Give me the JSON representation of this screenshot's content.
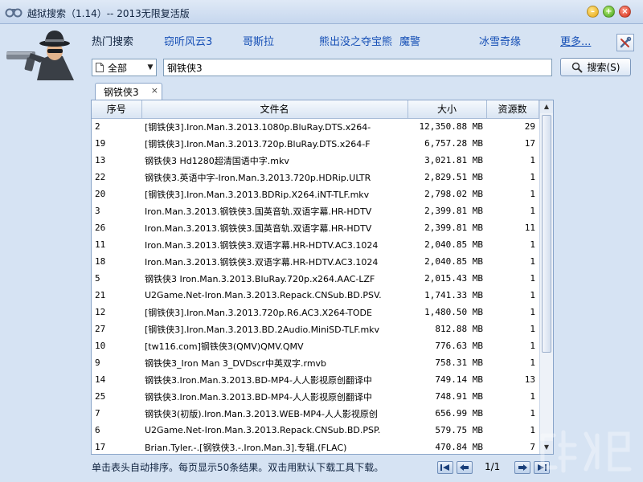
{
  "window": {
    "title": "越狱搜索（1.14）-- 2013无限复活版",
    "app_icon": "handcuffs-icon",
    "controls": [
      "minimize",
      "maximize",
      "close"
    ]
  },
  "hot_search": {
    "label": "热门搜索",
    "links": [
      "窃听风云3",
      "哥斯拉",
      "熊出没之夺宝熊",
      "魔警",
      "冰雪奇缘"
    ],
    "more_label": "更多..."
  },
  "search": {
    "scope_value": "全部",
    "query": "钢铁侠3",
    "button_label": "搜索(S)"
  },
  "tabs": [
    {
      "label": "钢铁侠3",
      "close_glyph": "×"
    }
  ],
  "table": {
    "columns": [
      "序号",
      "文件名",
      "大小",
      "资源数"
    ],
    "rows": [
      {
        "no": "2",
        "name": "[钢铁侠3].Iron.Man.3.2013.1080p.BluRay.DTS.x264-",
        "size": "12,350.88 MB",
        "sources": "29"
      },
      {
        "no": "19",
        "name": "[钢铁侠3].Iron.Man.3.2013.720p.BluRay.DTS.x264-F",
        "size": "6,757.28 MB",
        "sources": "17"
      },
      {
        "no": "13",
        "name": "钢铁侠3 Hd1280超清国语中字.mkv",
        "size": "3,021.81 MB",
        "sources": "1"
      },
      {
        "no": "22",
        "name": "钢铁侠3.英语中字-Iron.Man.3.2013.720p.HDRip.ULTR",
        "size": "2,829.51 MB",
        "sources": "1"
      },
      {
        "no": "20",
        "name": "[钢铁侠3].Iron.Man.3.2013.BDRip.X264.iNT-TLF.mkv",
        "size": "2,798.02 MB",
        "sources": "1"
      },
      {
        "no": "3",
        "name": "Iron.Man.3.2013.钢铁侠3.国英音轨.双语字幕.HR-HDTV",
        "size": "2,399.81 MB",
        "sources": "1"
      },
      {
        "no": "26",
        "name": "Iron.Man.3.2013.钢铁侠3.国英音轨.双语字幕.HR-HDTV",
        "size": "2,399.81 MB",
        "sources": "11"
      },
      {
        "no": "11",
        "name": "Iron.Man.3.2013.钢铁侠3.双语字幕.HR-HDTV.AC3.1024",
        "size": "2,040.85 MB",
        "sources": "1"
      },
      {
        "no": "18",
        "name": "Iron.Man.3.2013.钢铁侠3.双语字幕.HR-HDTV.AC3.1024",
        "size": "2,040.85 MB",
        "sources": "1"
      },
      {
        "no": "5",
        "name": "钢铁侠3 Iron.Man.3.2013.BluRay.720p.x264.AAC-LZF",
        "size": "2,015.43 MB",
        "sources": "1"
      },
      {
        "no": "21",
        "name": "U2Game.Net-Iron.Man.3.2013.Repack.CNSub.BD.PSV.",
        "size": "1,741.33 MB",
        "sources": "1"
      },
      {
        "no": "12",
        "name": "[钢铁侠3].Iron.Man.3.2013.720p.R6.AC3.X264-TODE",
        "size": "1,480.50 MB",
        "sources": "1"
      },
      {
        "no": "27",
        "name": "[钢铁侠3].Iron.Man.3.2013.BD.2Audio.MiniSD-TLF.mkv",
        "size": "812.88 MB",
        "sources": "1"
      },
      {
        "no": "10",
        "name": "[tw116.com]钢铁侠3(QMV)QMV.QMV",
        "size": "776.63 MB",
        "sources": "1"
      },
      {
        "no": "9",
        "name": "钢铁侠3_Iron Man 3_DVDscr中英双字.rmvb",
        "size": "758.31 MB",
        "sources": "1"
      },
      {
        "no": "14",
        "name": "钢铁侠3.Iron.Man.3.2013.BD-MP4-人人影视原创翻译中",
        "size": "749.14 MB",
        "sources": "13"
      },
      {
        "no": "25",
        "name": "钢铁侠3.Iron.Man.3.2013.BD-MP4-人人影视原创翻译中",
        "size": "748.91 MB",
        "sources": "1"
      },
      {
        "no": "7",
        "name": "钢铁侠3(初版).Iron.Man.3.2013.WEB-MP4-人人影视原创",
        "size": "656.99 MB",
        "sources": "1"
      },
      {
        "no": "6",
        "name": "U2Game.Net-Iron.Man.3.2013.Repack.CNSub.BD.PSP.",
        "size": "579.75 MB",
        "sources": "1"
      },
      {
        "no": "17",
        "name": "Brian.Tyler.-.[钢铁侠3.-.Iron.Man.3].专辑.(FLAC)",
        "size": "470.84 MB",
        "sources": "7"
      }
    ]
  },
  "status": {
    "hint": "单击表头自动排序。每页显示50条结果。双击用默认下载工具下载。",
    "page_indicator": "1/1"
  },
  "icons": {
    "mascot": "spy-with-gun-icon",
    "settings": "settings-tools-icon",
    "scope": "document-icon",
    "search": "magnifier-icon"
  },
  "colors": {
    "background": "#d6e3f3",
    "link": "#1750b6",
    "title_text": "#10233f"
  }
}
